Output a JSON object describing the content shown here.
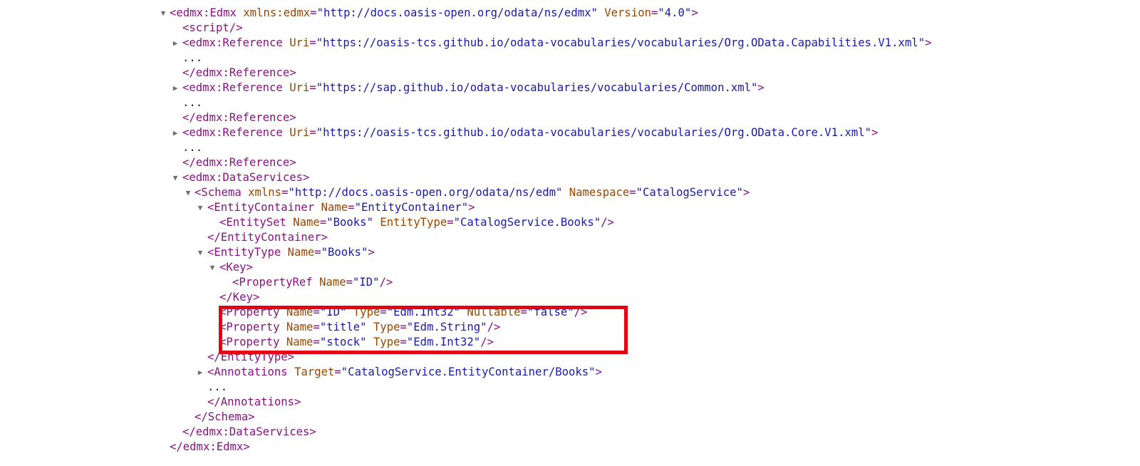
{
  "toggles": {
    "expanded": "▼",
    "collapsed": "▶"
  },
  "lines": [
    {
      "tokens": [
        {
          "t": "tag",
          "v": "<edmx:Edmx"
        },
        {
          "t": "pl",
          "v": " "
        },
        {
          "t": "an",
          "v": "xmlns:edmx"
        },
        {
          "t": "tag",
          "v": "="
        },
        {
          "t": "av",
          "v": "\"http://docs.oasis-open.org/odata/ns/edmx\""
        },
        {
          "t": "pl",
          "v": " "
        },
        {
          "t": "an",
          "v": "Version"
        },
        {
          "t": "tag",
          "v": "="
        },
        {
          "t": "av",
          "v": "\"4.0\""
        },
        {
          "t": "tag",
          "v": ">"
        }
      ]
    },
    {
      "tokens": [
        {
          "t": "tag",
          "v": "<script/>"
        }
      ]
    },
    {
      "tokens": [
        {
          "t": "tag",
          "v": "<edmx:Reference"
        },
        {
          "t": "pl",
          "v": " "
        },
        {
          "t": "an",
          "v": "Uri"
        },
        {
          "t": "tag",
          "v": "="
        },
        {
          "t": "av",
          "v": "\"https://oasis-tcs.github.io/odata-vocabularies/vocabularies/Org.OData.Capabilities.V1.xml\""
        },
        {
          "t": "tag",
          "v": ">"
        }
      ]
    },
    {
      "tokens": [
        {
          "t": "pl",
          "v": "..."
        }
      ]
    },
    {
      "tokens": [
        {
          "t": "tag",
          "v": "</edmx:Reference>"
        }
      ]
    },
    {
      "tokens": [
        {
          "t": "tag",
          "v": "<edmx:Reference"
        },
        {
          "t": "pl",
          "v": " "
        },
        {
          "t": "an",
          "v": "Uri"
        },
        {
          "t": "tag",
          "v": "="
        },
        {
          "t": "av",
          "v": "\"https://sap.github.io/odata-vocabularies/vocabularies/Common.xml\""
        },
        {
          "t": "tag",
          "v": ">"
        }
      ]
    },
    {
      "tokens": [
        {
          "t": "pl",
          "v": "..."
        }
      ]
    },
    {
      "tokens": [
        {
          "t": "tag",
          "v": "</edmx:Reference>"
        }
      ]
    },
    {
      "tokens": [
        {
          "t": "tag",
          "v": "<edmx:Reference"
        },
        {
          "t": "pl",
          "v": " "
        },
        {
          "t": "an",
          "v": "Uri"
        },
        {
          "t": "tag",
          "v": "="
        },
        {
          "t": "av",
          "v": "\"https://oasis-tcs.github.io/odata-vocabularies/vocabularies/Org.OData.Core.V1.xml\""
        },
        {
          "t": "tag",
          "v": ">"
        }
      ]
    },
    {
      "tokens": [
        {
          "t": "pl",
          "v": "..."
        }
      ]
    },
    {
      "tokens": [
        {
          "t": "tag",
          "v": "</edmx:Reference>"
        }
      ]
    },
    {
      "tokens": [
        {
          "t": "tag",
          "v": "<edmx:DataServices>"
        }
      ]
    },
    {
      "tokens": [
        {
          "t": "tag",
          "v": "<Schema"
        },
        {
          "t": "pl",
          "v": " "
        },
        {
          "t": "an",
          "v": "xmlns"
        },
        {
          "t": "tag",
          "v": "="
        },
        {
          "t": "av",
          "v": "\"http://docs.oasis-open.org/odata/ns/edm\""
        },
        {
          "t": "pl",
          "v": " "
        },
        {
          "t": "an",
          "v": "Namespace"
        },
        {
          "t": "tag",
          "v": "="
        },
        {
          "t": "av",
          "v": "\"CatalogService\""
        },
        {
          "t": "tag",
          "v": ">"
        }
      ]
    },
    {
      "tokens": [
        {
          "t": "tag",
          "v": "<EntityContainer"
        },
        {
          "t": "pl",
          "v": " "
        },
        {
          "t": "an",
          "v": "Name"
        },
        {
          "t": "tag",
          "v": "="
        },
        {
          "t": "av",
          "v": "\"EntityContainer\""
        },
        {
          "t": "tag",
          "v": ">"
        }
      ]
    },
    {
      "tokens": [
        {
          "t": "tag",
          "v": "<EntitySet"
        },
        {
          "t": "pl",
          "v": " "
        },
        {
          "t": "an",
          "v": "Name"
        },
        {
          "t": "tag",
          "v": "="
        },
        {
          "t": "av",
          "v": "\"Books\""
        },
        {
          "t": "pl",
          "v": " "
        },
        {
          "t": "an",
          "v": "EntityType"
        },
        {
          "t": "tag",
          "v": "="
        },
        {
          "t": "av",
          "v": "\"CatalogService.Books\""
        },
        {
          "t": "tag",
          "v": "/>"
        }
      ]
    },
    {
      "tokens": [
        {
          "t": "tag",
          "v": "</EntityContainer>"
        }
      ]
    },
    {
      "tokens": [
        {
          "t": "tag",
          "v": "<EntityType"
        },
        {
          "t": "pl",
          "v": " "
        },
        {
          "t": "an",
          "v": "Name"
        },
        {
          "t": "tag",
          "v": "="
        },
        {
          "t": "av",
          "v": "\"Books\""
        },
        {
          "t": "tag",
          "v": ">"
        }
      ]
    },
    {
      "tokens": [
        {
          "t": "tag",
          "v": "<Key>"
        }
      ]
    },
    {
      "tokens": [
        {
          "t": "tag",
          "v": "<PropertyRef"
        },
        {
          "t": "pl",
          "v": " "
        },
        {
          "t": "an",
          "v": "Name"
        },
        {
          "t": "tag",
          "v": "="
        },
        {
          "t": "av",
          "v": "\"ID\""
        },
        {
          "t": "tag",
          "v": "/>"
        }
      ]
    },
    {
      "tokens": [
        {
          "t": "tag",
          "v": "</Key>"
        }
      ]
    },
    {
      "tokens": [
        {
          "t": "tag",
          "v": "<Property"
        },
        {
          "t": "pl",
          "v": " "
        },
        {
          "t": "an",
          "v": "Name"
        },
        {
          "t": "tag",
          "v": "="
        },
        {
          "t": "av",
          "v": "\"ID\""
        },
        {
          "t": "pl",
          "v": " "
        },
        {
          "t": "an",
          "v": "Type"
        },
        {
          "t": "tag",
          "v": "="
        },
        {
          "t": "av",
          "v": "\"Edm.Int32\""
        },
        {
          "t": "pl",
          "v": " "
        },
        {
          "t": "an",
          "v": "Nullable"
        },
        {
          "t": "tag",
          "v": "="
        },
        {
          "t": "av",
          "v": "\"false\""
        },
        {
          "t": "tag",
          "v": "/>"
        }
      ]
    },
    {
      "tokens": [
        {
          "t": "tag",
          "v": "<Property"
        },
        {
          "t": "pl",
          "v": " "
        },
        {
          "t": "an",
          "v": "Name"
        },
        {
          "t": "tag",
          "v": "="
        },
        {
          "t": "av",
          "v": "\"title\""
        },
        {
          "t": "pl",
          "v": " "
        },
        {
          "t": "an",
          "v": "Type"
        },
        {
          "t": "tag",
          "v": "="
        },
        {
          "t": "av",
          "v": "\"Edm.String\""
        },
        {
          "t": "tag",
          "v": "/>"
        }
      ]
    },
    {
      "tokens": [
        {
          "t": "tag",
          "v": "<Property"
        },
        {
          "t": "pl",
          "v": " "
        },
        {
          "t": "an",
          "v": "Name"
        },
        {
          "t": "tag",
          "v": "="
        },
        {
          "t": "av",
          "v": "\"stock\""
        },
        {
          "t": "pl",
          "v": " "
        },
        {
          "t": "an",
          "v": "Type"
        },
        {
          "t": "tag",
          "v": "="
        },
        {
          "t": "av",
          "v": "\"Edm.Int32\""
        },
        {
          "t": "tag",
          "v": "/>"
        }
      ]
    },
    {
      "tokens": [
        {
          "t": "tag",
          "v": "</EntityType>"
        }
      ]
    },
    {
      "tokens": [
        {
          "t": "tag",
          "v": "<Annotations"
        },
        {
          "t": "pl",
          "v": " "
        },
        {
          "t": "an",
          "v": "Target"
        },
        {
          "t": "tag",
          "v": "="
        },
        {
          "t": "av",
          "v": "\"CatalogService.EntityContainer/Books\""
        },
        {
          "t": "tag",
          "v": ">"
        }
      ]
    },
    {
      "tokens": [
        {
          "t": "pl",
          "v": "..."
        }
      ]
    },
    {
      "tokens": [
        {
          "t": "tag",
          "v": "</Annotations>"
        }
      ]
    },
    {
      "tokens": [
        {
          "t": "tag",
          "v": "</Schema>"
        }
      ]
    },
    {
      "tokens": [
        {
          "t": "tag",
          "v": "</edmx:DataServices>"
        }
      ]
    },
    {
      "tokens": [
        {
          "t": "tag",
          "v": "</edmx:Edmx>"
        }
      ]
    }
  ],
  "highlight": {
    "color": "#e60012"
  },
  "colors": {
    "tag": "#881280",
    "attribute_name": "#994500",
    "attribute_value": "#1a1aa6",
    "text": "#222222"
  }
}
